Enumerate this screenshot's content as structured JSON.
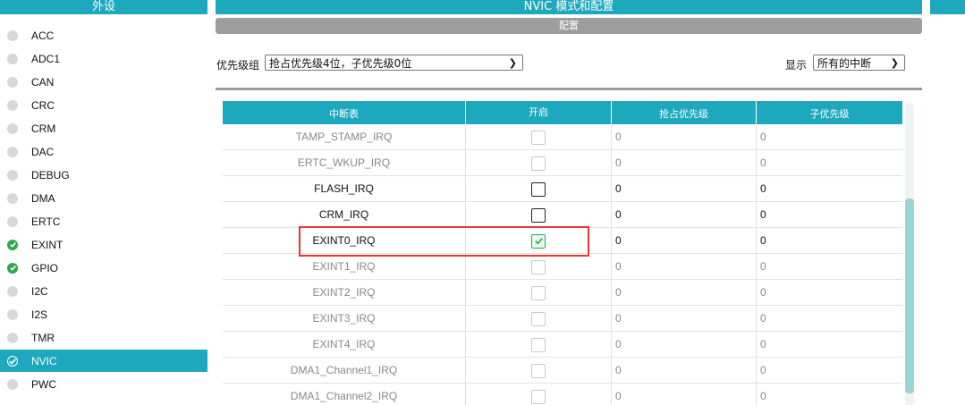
{
  "sidebar": {
    "title": "外设",
    "items": [
      {
        "label": "ACC",
        "status": "none"
      },
      {
        "label": "ADC1",
        "status": "none"
      },
      {
        "label": "CAN",
        "status": "none"
      },
      {
        "label": "CRC",
        "status": "none"
      },
      {
        "label": "CRM",
        "status": "none"
      },
      {
        "label": "DAC",
        "status": "none"
      },
      {
        "label": "DEBUG",
        "status": "none"
      },
      {
        "label": "DMA",
        "status": "none"
      },
      {
        "label": "ERTC",
        "status": "none"
      },
      {
        "label": "EXINT",
        "status": "ok"
      },
      {
        "label": "GPIO",
        "status": "ok"
      },
      {
        "label": "I2C",
        "status": "none"
      },
      {
        "label": "I2S",
        "status": "none"
      },
      {
        "label": "TMR",
        "status": "none"
      },
      {
        "label": "NVIC",
        "status": "active"
      },
      {
        "label": "PWC",
        "status": "none"
      }
    ]
  },
  "main": {
    "title": "NVIC 模式和配置",
    "config_label": "配置",
    "priority_group_label": "优先级组",
    "priority_group_value": "抢占优先级4位，子优先级0位",
    "show_label": "显示",
    "show_value": "所有的中断"
  },
  "table": {
    "headers": [
      "中断表",
      "开启",
      "抢占优先级",
      "子优先级"
    ],
    "rows": [
      {
        "name": "TAMP_STAMP_IRQ",
        "enabled": false,
        "preempt": "0",
        "sub": "0",
        "active": false
      },
      {
        "name": "ERTC_WKUP_IRQ",
        "enabled": false,
        "preempt": "0",
        "sub": "0",
        "active": false
      },
      {
        "name": "FLASH_IRQ",
        "enabled": false,
        "preempt": "0",
        "sub": "0",
        "active": true
      },
      {
        "name": "CRM_IRQ",
        "enabled": false,
        "preempt": "0",
        "sub": "0",
        "active": true
      },
      {
        "name": "EXINT0_IRQ",
        "enabled": true,
        "preempt": "0",
        "sub": "0",
        "active": true
      },
      {
        "name": "EXINT1_IRQ",
        "enabled": false,
        "preempt": "0",
        "sub": "0",
        "active": false
      },
      {
        "name": "EXINT2_IRQ",
        "enabled": false,
        "preempt": "0",
        "sub": "0",
        "active": false
      },
      {
        "name": "EXINT3_IRQ",
        "enabled": false,
        "preempt": "0",
        "sub": "0",
        "active": false
      },
      {
        "name": "EXINT4_IRQ",
        "enabled": false,
        "preempt": "0",
        "sub": "0",
        "active": false
      },
      {
        "name": "DMA1_Channel1_IRQ",
        "enabled": false,
        "preempt": "0",
        "sub": "0",
        "active": false
      },
      {
        "name": "DMA1_Channel2_IRQ",
        "enabled": false,
        "preempt": "0",
        "sub": "0",
        "active": false
      }
    ]
  },
  "colors": {
    "accent": "#1ea8be",
    "ok": "#2fa84f",
    "highlight": "#e53935"
  }
}
